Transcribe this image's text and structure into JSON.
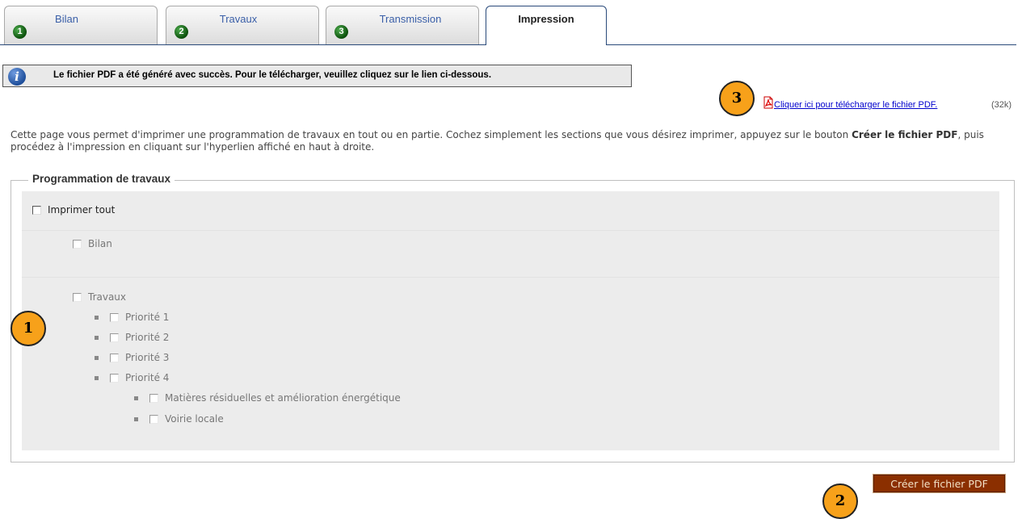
{
  "tabs": [
    {
      "number": "1",
      "label": "Bilan"
    },
    {
      "number": "2",
      "label": "Travaux"
    },
    {
      "number": "3",
      "label": "Transmission"
    },
    {
      "label": "Impression",
      "active": true
    }
  ],
  "info": {
    "message": "Le fichier PDF a été généré avec succès. Pour le télécharger, veuillez cliquez sur le lien ci-dessous.",
    "icon": "info-icon"
  },
  "download": {
    "link_text": "Cliquer ici pour télécharger le fichier PDF.",
    "size": "(32k)",
    "icon": "pdf-icon"
  },
  "description": {
    "part1": "Cette page vous permet d'imprimer une programmation de travaux en tout ou en partie. Cochez simplement les sections que vous désirez imprimer, appuyez sur le bouton ",
    "bold": "Créer le fichier PDF",
    "part2": ", puis procédez à l'impression en cliquant sur l'hyperlien affiché en haut à droite."
  },
  "fieldset": {
    "legend": "Programmation de travaux",
    "print_all": "Imprimer tout",
    "bilan": "Bilan",
    "travaux": "Travaux",
    "priorities": [
      "Priorité 1",
      "Priorité 2",
      "Priorité 3",
      "Priorité 4"
    ],
    "sub_priority_4": [
      "Matières résiduelles et amélioration énergétique",
      "Voirie locale"
    ]
  },
  "buttons": {
    "create_pdf": "Créer le fichier PDF"
  },
  "callouts": [
    "1",
    "2",
    "3"
  ],
  "colors": {
    "button_bg": "#8b2f00",
    "callout": "#f7a11a",
    "tab_active_border": "#2a4a7a"
  }
}
